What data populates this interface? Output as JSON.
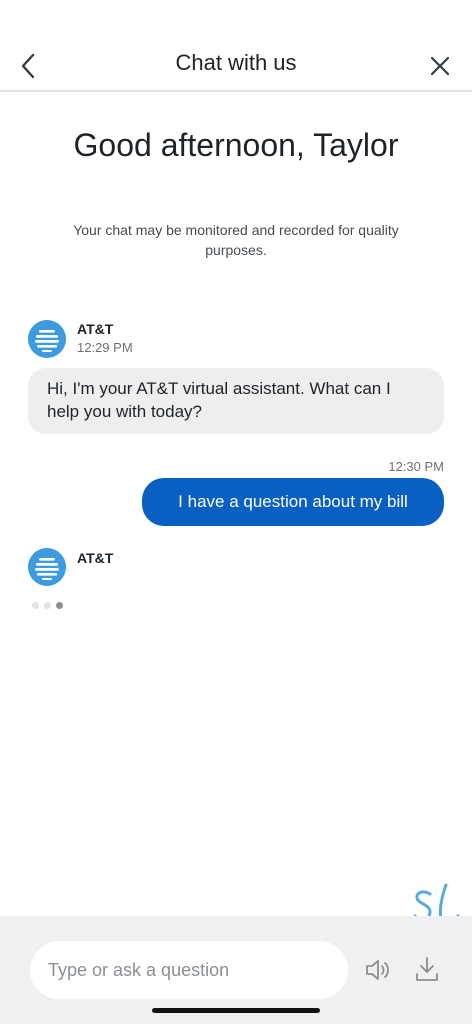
{
  "header": {
    "title": "Chat with us",
    "back_icon": "chevron-left-icon",
    "close_icon": "close-icon"
  },
  "welcome": {
    "greeting": "Good afternoon, Taylor",
    "disclaimer": "Your chat may be monitored and recorded for quality purposes."
  },
  "messages": [
    {
      "from": "agent",
      "sender": "AT&T",
      "time": "12:29 PM",
      "text": "Hi, I'm your AT&T virtual assistant. What can I help you with today?"
    },
    {
      "from": "user",
      "time": "12:30 PM",
      "text": "I have a question about my bill"
    },
    {
      "from": "agent",
      "sender": "AT&T",
      "typing": true
    }
  ],
  "composer": {
    "placeholder": "Type or ask a question",
    "speaker_icon": "speaker-icon",
    "download_icon": "download-icon"
  },
  "colors": {
    "user_bubble": "#0a5fc2",
    "agent_bubble": "#eeeeee",
    "avatar": "#3f9be0",
    "brand_mark": "#5aa9dd"
  }
}
